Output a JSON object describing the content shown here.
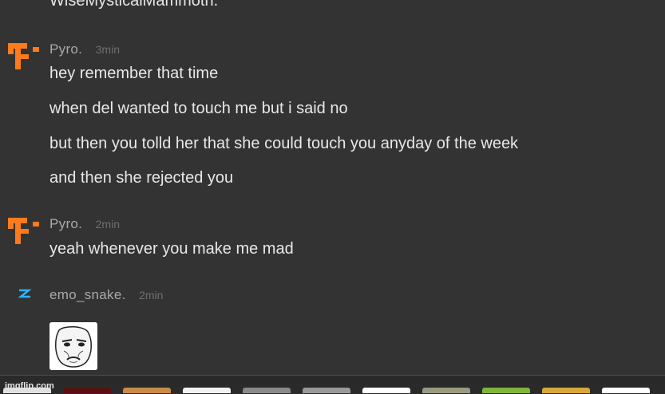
{
  "previous_message_tail": "WiseMysticalMammoth.",
  "messages": [
    {
      "username": "Pyro.",
      "time": "3min",
      "avatar_icon": "pyro-logo-icon",
      "avatar_color": "#ff7a1a",
      "lines": [
        "hey remember that time",
        "when del wanted to touch me but i said no",
        "but then you tolld her that she could touch you anyday of the week",
        "and then she rejected you"
      ]
    },
    {
      "username": "Pyro.",
      "time": "2min",
      "avatar_icon": "pyro-logo-icon",
      "avatar_color": "#ff7a1a",
      "lines": [
        "yeah whenever you make me mad"
      ]
    },
    {
      "username": "emo_snake.",
      "time": "2min",
      "avatar_icon": "snake-logo-icon",
      "avatar_color": "#2bb5ff",
      "attachment_icon": "meme-face-sticker-icon"
    }
  ],
  "watermark": "imgflip.com",
  "meme_tray": {
    "thumb_colors": [
      "#e0e0e0",
      "#5a1010",
      "#c98a4a",
      "#f2f2f2",
      "#8a8a8a",
      "#9a9a9a",
      "#ffffff",
      "#9a9a80",
      "#7fb53a",
      "#d6a93a",
      "#ffffff"
    ]
  }
}
